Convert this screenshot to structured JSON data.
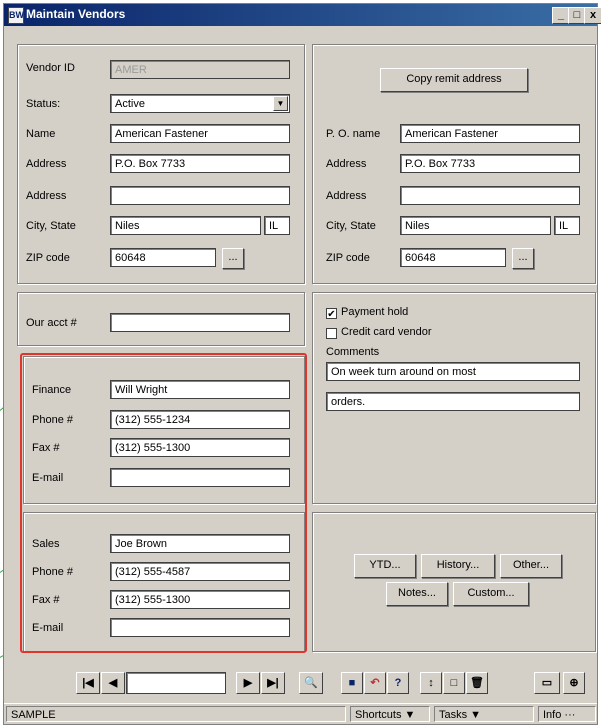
{
  "window": {
    "title": "Maintain Vendors",
    "icon_text": "BW",
    "minimize": "_",
    "maximize": "□",
    "close": "x"
  },
  "vendor": {
    "id_label": "Vendor ID",
    "id_value": "AMER",
    "status_label": "Status:",
    "status_value": "Active",
    "name_label": "Name",
    "name_value": "American Fastener",
    "address_label": "Address",
    "address_value": "P.O. Box 7733",
    "address2_label": "Address",
    "address2_value": "",
    "city_label": "City, State",
    "city_value": "Niles",
    "state_value": "IL",
    "zip_label": "ZIP code",
    "zip_value": "60648",
    "zip_btn": "..."
  },
  "remit": {
    "copy_btn": "Copy remit address",
    "po_label": "P. O. name",
    "po_value": "American Fastener",
    "address_label": "Address",
    "address_value": "P.O. Box 7733",
    "address2_label": "Address",
    "address2_value": "",
    "city_label": "City, State",
    "city_value": "Niles",
    "state_value": "IL",
    "zip_label": "ZIP code",
    "zip_value": "60648",
    "zip_btn": "..."
  },
  "account": {
    "label": "Our acct #",
    "value": ""
  },
  "options": {
    "payment_hold_label": "Payment hold",
    "payment_hold_checked": "✔",
    "credit_card_label": "Credit card vendor",
    "credit_card_checked": "",
    "comments_label": "Comments",
    "comment_line1": "On week turn around on most",
    "comment_line2": "orders."
  },
  "finance": {
    "label": "Finance",
    "name": "Will Wright",
    "phone_label": "Phone #",
    "phone": "(312) 555-1234",
    "fax_label": "Fax #",
    "fax": "(312) 555-1300",
    "email_label": "E-mail",
    "email": ""
  },
  "sales": {
    "label": "Sales",
    "name": "Joe Brown",
    "phone_label": "Phone #",
    "phone": "(312) 555-4587",
    "fax_label": "Fax #",
    "fax": "(312) 555-1300",
    "email_label": "E-mail",
    "email": ""
  },
  "buttons": {
    "ytd": "YTD...",
    "history": "History...",
    "other": "Other...",
    "notes": "Notes...",
    "custom": "Custom..."
  },
  "toolbar": {
    "first": "|◀",
    "prev": "◀",
    "record": "",
    "next": "▶",
    "last": "▶|",
    "find": "🔍",
    "save": "■",
    "undo": "↶",
    "help": "?",
    "sort": "↕",
    "new": "□",
    "delete": "🗑",
    "print": "▭",
    "attach": "⊕"
  },
  "statusbar": {
    "mode": "SAMPLE",
    "shortcuts": "Shortcuts ▼",
    "tasks": "Tasks ▼",
    "info": "Info ···"
  },
  "colors": {
    "highlight": "#e0352b",
    "callout": "#3aa04a",
    "titlebar": "#0a246a"
  }
}
